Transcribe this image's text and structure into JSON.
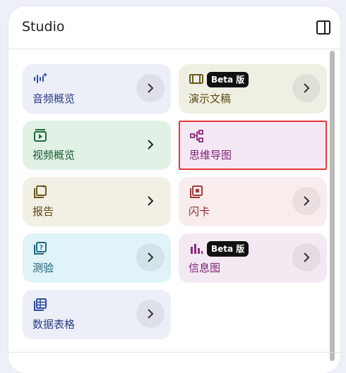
{
  "studio": {
    "title": "Studio",
    "cards": [
      {
        "label": "音频概览",
        "icon": "audio-waveform-icon",
        "badge": null
      },
      {
        "label": "演示文稿",
        "icon": "slides-icon",
        "badge": "Beta 版"
      },
      {
        "label": "视频概览",
        "icon": "video-play-icon",
        "badge": null
      },
      {
        "label": "思维导图",
        "icon": "mind-map-icon",
        "badge": null
      },
      {
        "label": "报告",
        "icon": "report-icon",
        "badge": null
      },
      {
        "label": "闪卡",
        "icon": "flashcards-icon",
        "badge": null
      },
      {
        "label": "测验",
        "icon": "quiz-icon",
        "badge": null
      },
      {
        "label": "信息图",
        "icon": "infographic-icon",
        "badge": "Beta 版"
      },
      {
        "label": "数据表格",
        "icon": "data-table-icon",
        "badge": null
      }
    ]
  },
  "colors": {
    "blue_card": "#eceef8",
    "olive_card": "#f0efe4",
    "green_card": "#e1f1e5",
    "purple_card": "#f4e8f4",
    "beige_card": "#f2efe4",
    "pink_card": "#f9eced",
    "cyan_card": "#dff3f8",
    "mauve_card": "#f3e9f2",
    "highlight_outline": "#e53935"
  }
}
